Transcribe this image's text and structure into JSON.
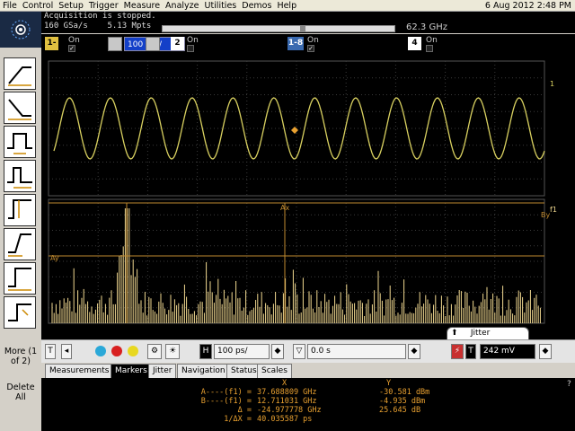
{
  "menu": [
    "File",
    "Control",
    "Setup",
    "Trigger",
    "Measure",
    "Analyze",
    "Utilities",
    "Demos",
    "Help"
  ],
  "datetime": "6 Aug 2012 2:48 PM",
  "status": {
    "message": "Acquisition is stopped.",
    "rate": "160 GSa/s",
    "points": "5.13 Mpts",
    "freq_readout": "62.3 GHz"
  },
  "channels": {
    "ch1_label": "1-8",
    "ch1_on": "On",
    "ch1_scale": "100 mV/",
    "ch2_label": "2",
    "ch2_on": "On",
    "ch3_label": "1-8",
    "ch3_on": "On",
    "ch4_label": "4",
    "ch4_on": "On",
    "check_mark": "✓"
  },
  "side": {
    "more": "More (1 of 2)",
    "delete_all": "Delete All"
  },
  "controls": {
    "t_label": "T",
    "h_label": "H",
    "timebase": "100 ps/",
    "delay": "0.0 s",
    "trigger_level": "242 mV",
    "jitter_label": "Jitter"
  },
  "tabs": [
    "Measurements",
    "Markers",
    "Jitter",
    "Navigation",
    "Status",
    "Scales"
  ],
  "markers": {
    "col_x": "X",
    "col_y": "Y",
    "rows": [
      {
        "label": "A----(f1) =",
        "x": "37.688809 GHz",
        "y": "-30.581 dBm"
      },
      {
        "label": "B----(f1) =",
        "x": "12.711031 GHz",
        "y": "-4.935 dBm"
      },
      {
        "label": "Δ =",
        "x": "-24.977778 GHz",
        "y": "25.645 dB"
      },
      {
        "label": "1/ΔX =",
        "x": "40.035587 ps",
        "y": ""
      }
    ]
  },
  "help": "?",
  "trace_labels": {
    "ax": "Ax",
    "ay": "Ay",
    "by": "By",
    "f1": "f1",
    "one": "1"
  },
  "colors": {
    "trace": "#d8d060",
    "fft": "#f0d890",
    "marker": "#c08a30",
    "grid": "#3a3a3a"
  }
}
